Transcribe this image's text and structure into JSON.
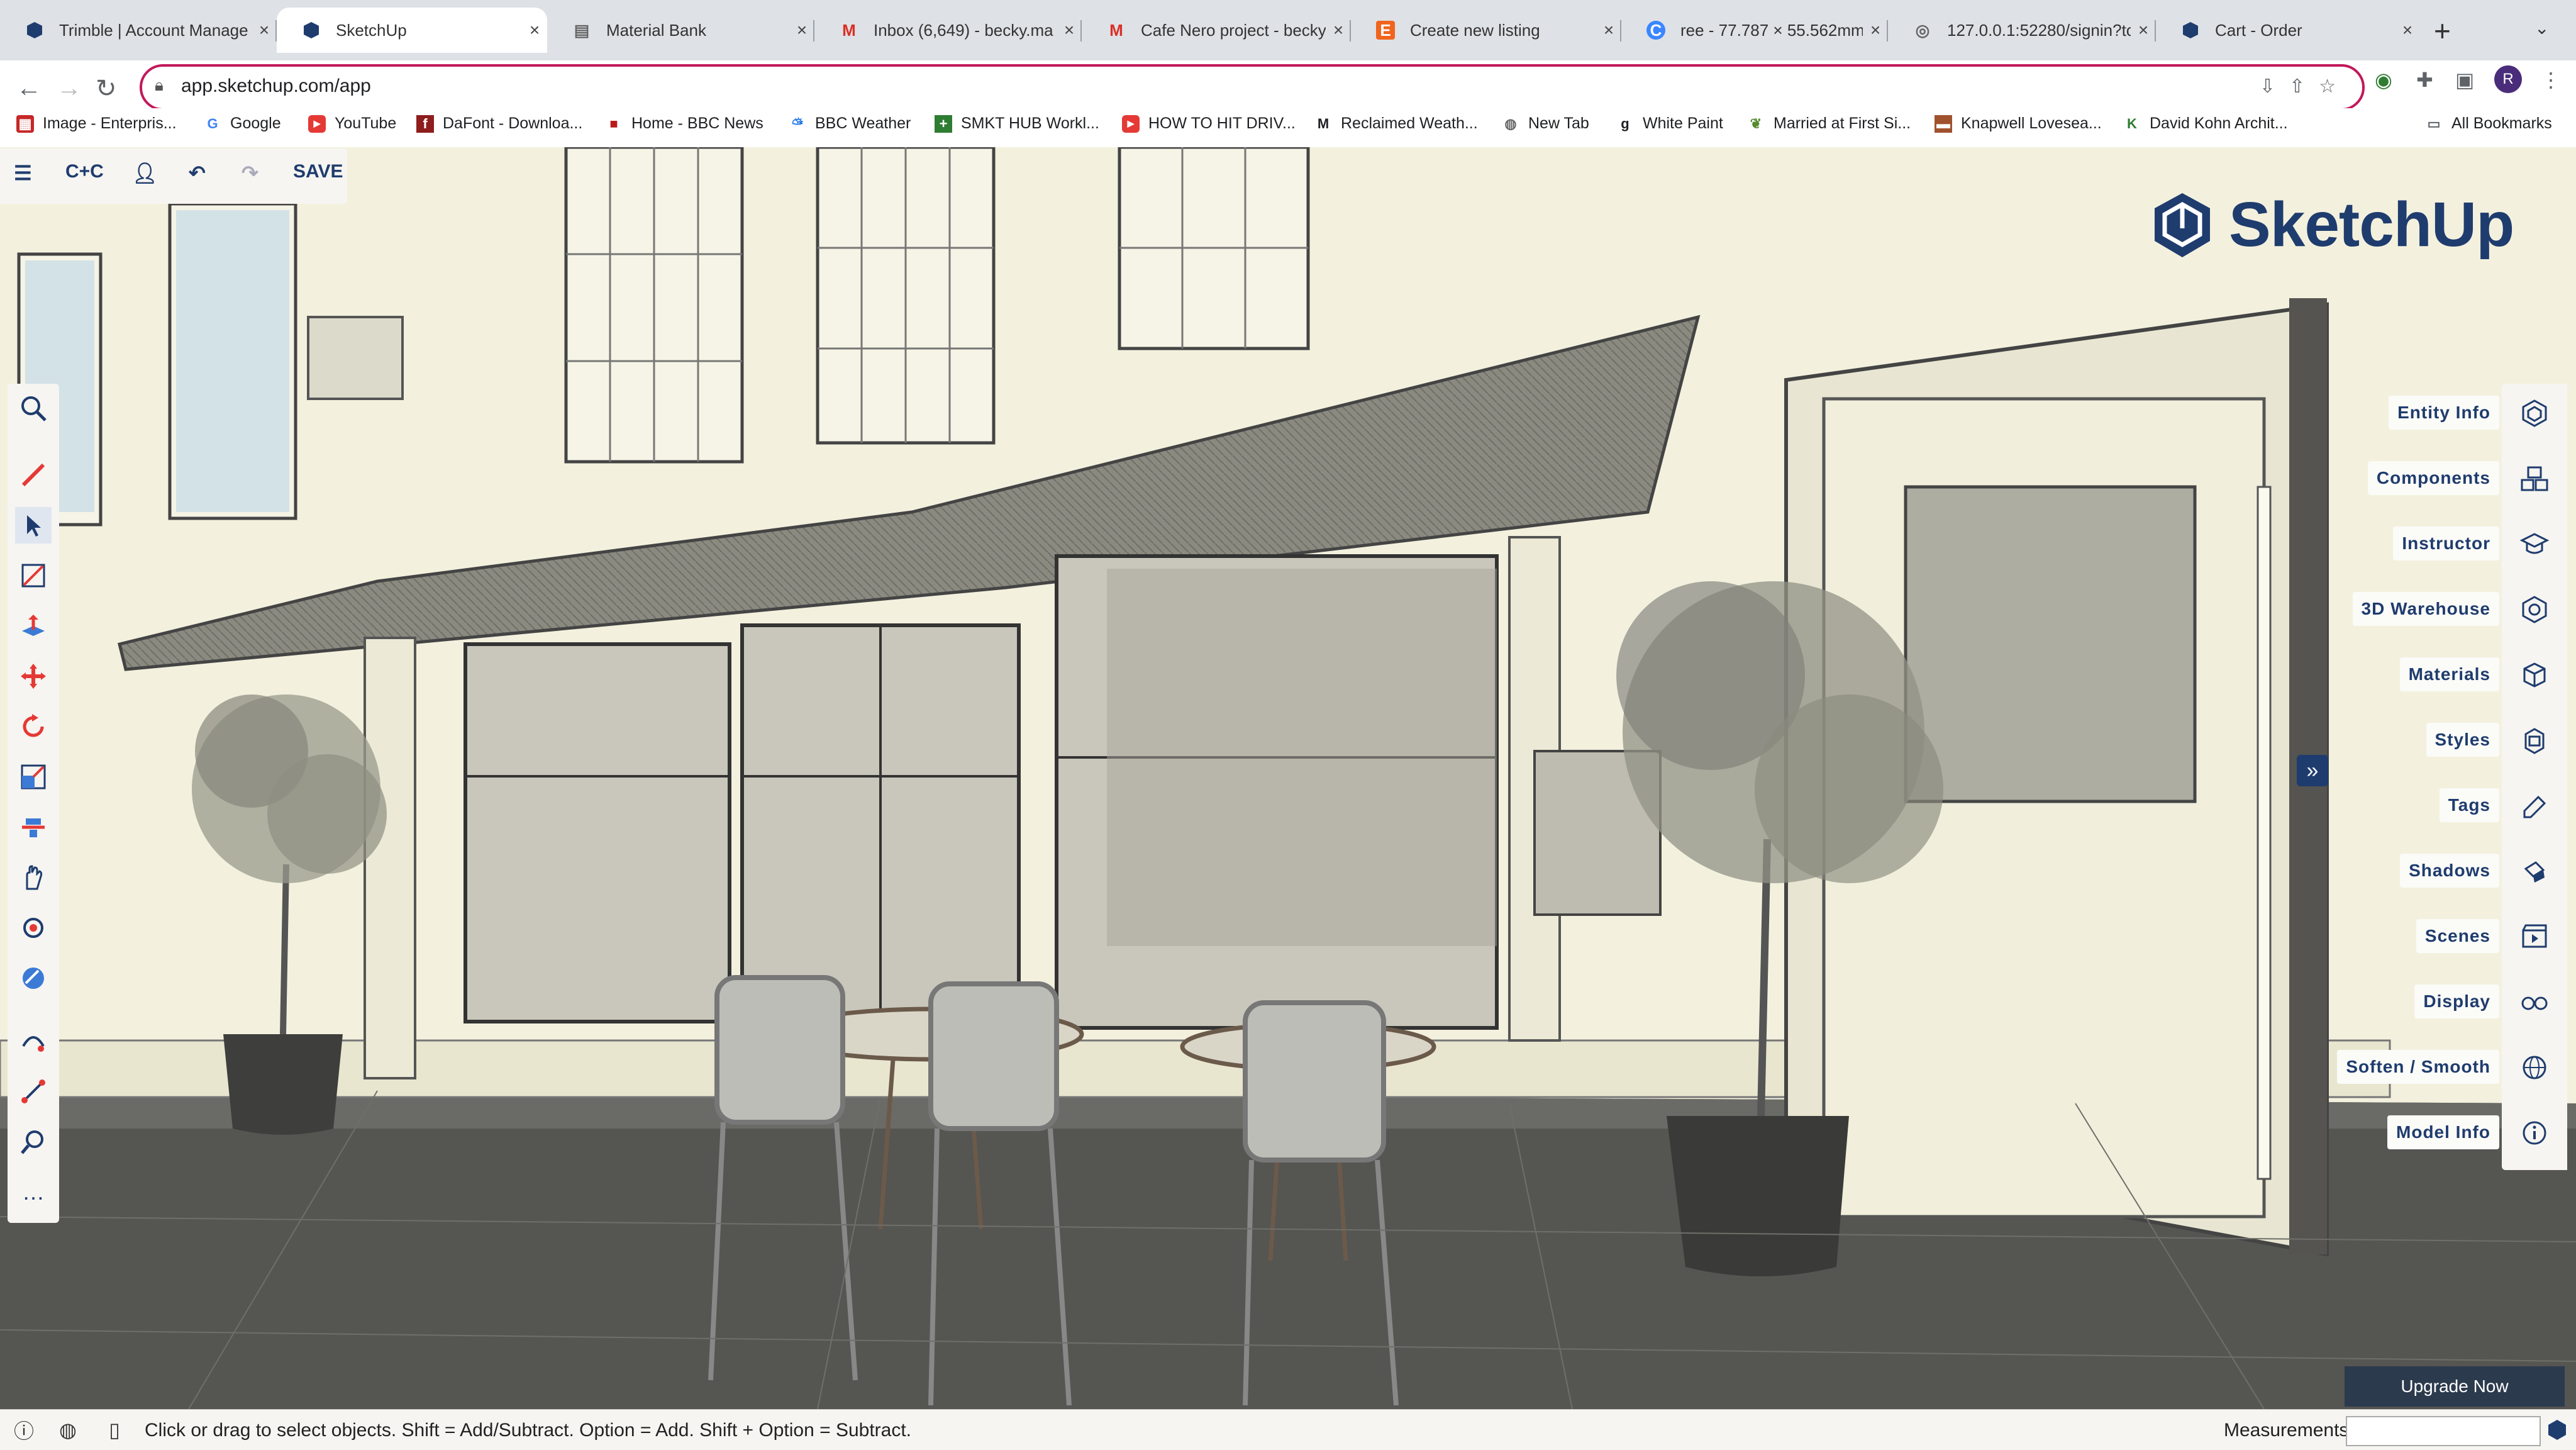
{
  "browser": {
    "tabs": [
      {
        "title": "Trimble | Account Manage",
        "icon": "sketchup-icon",
        "active": false
      },
      {
        "title": "SketchUp",
        "icon": "sketchup-icon",
        "active": true
      },
      {
        "title": "Material Bank",
        "icon": "globe-icon",
        "active": false
      },
      {
        "title": "Inbox (6,649) - becky.ma",
        "icon": "gmail-icon",
        "active": false
      },
      {
        "title": "Cafe Nero project - becky",
        "icon": "gmail-icon",
        "active": false
      },
      {
        "title": "Create new listing",
        "icon": "etsy-icon",
        "active": false
      },
      {
        "title": "ree - 77.787 × 55.562mm",
        "icon": "canva-icon",
        "active": false
      },
      {
        "title": "127.0.0.1:52280/signin?to",
        "icon": "globe-icon",
        "active": false
      },
      {
        "title": "Cart - Order",
        "icon": "sketchup-icon",
        "active": false
      }
    ],
    "url": "app.sketchup.com/app",
    "profile_initial": "R",
    "bookmarks": [
      {
        "label": "Image - Enterpris...",
        "icon": "image-icon"
      },
      {
        "label": "Google",
        "icon": "google-icon"
      },
      {
        "label": "YouTube",
        "icon": "youtube-icon"
      },
      {
        "label": "DaFont - Downloa...",
        "icon": "dafont-icon"
      },
      {
        "label": "Home - BBC News",
        "icon": "bbc-icon"
      },
      {
        "label": "BBC Weather",
        "icon": "weather-icon"
      },
      {
        "label": "SMKT HUB Workl...",
        "icon": "hub-icon"
      },
      {
        "label": "HOW TO HIT DRIV...",
        "icon": "youtube-icon"
      },
      {
        "label": "Reclaimed Weath...",
        "icon": "m-icon"
      },
      {
        "label": "New Tab",
        "icon": "globe-icon"
      },
      {
        "label": "White Paint",
        "icon": "g-icon"
      },
      {
        "label": "Married at First Si...",
        "icon": "leaf-icon"
      },
      {
        "label": "Knapwell Lovesea...",
        "icon": "sofa-icon"
      },
      {
        "label": "David Kohn Archit...",
        "icon": "k-icon"
      }
    ],
    "all_bookmarks": "All Bookmarks"
  },
  "sketchup": {
    "top_bar": {
      "project": "C+C",
      "save": "SAVE"
    },
    "logo_text": "SketchUp",
    "right_panel": [
      {
        "label": "Entity Info",
        "icon": "entity-info-icon"
      },
      {
        "label": "Components",
        "icon": "components-icon"
      },
      {
        "label": "Instructor",
        "icon": "instructor-icon"
      },
      {
        "label": "3D Warehouse",
        "icon": "warehouse-icon"
      },
      {
        "label": "Materials",
        "icon": "materials-icon"
      },
      {
        "label": "Styles",
        "icon": "styles-icon"
      },
      {
        "label": "Tags",
        "icon": "tags-icon"
      },
      {
        "label": "Shadows",
        "icon": "shadows-icon"
      },
      {
        "label": "Scenes",
        "icon": "scenes-icon"
      },
      {
        "label": "Display",
        "icon": "display-icon"
      },
      {
        "label": "Soften / Smooth",
        "icon": "soften-icon"
      },
      {
        "label": "Model Info",
        "icon": "info-icon"
      }
    ],
    "upgrade": "Upgrade Now",
    "status_message": "Click or drag to select objects. Shift = Add/Subtract. Option = Add. Shift + Option = Subtract.",
    "measurements_label": "Measurements",
    "colors": {
      "brand": "#1f3c6e",
      "address_highlight": "#c2185b"
    }
  }
}
